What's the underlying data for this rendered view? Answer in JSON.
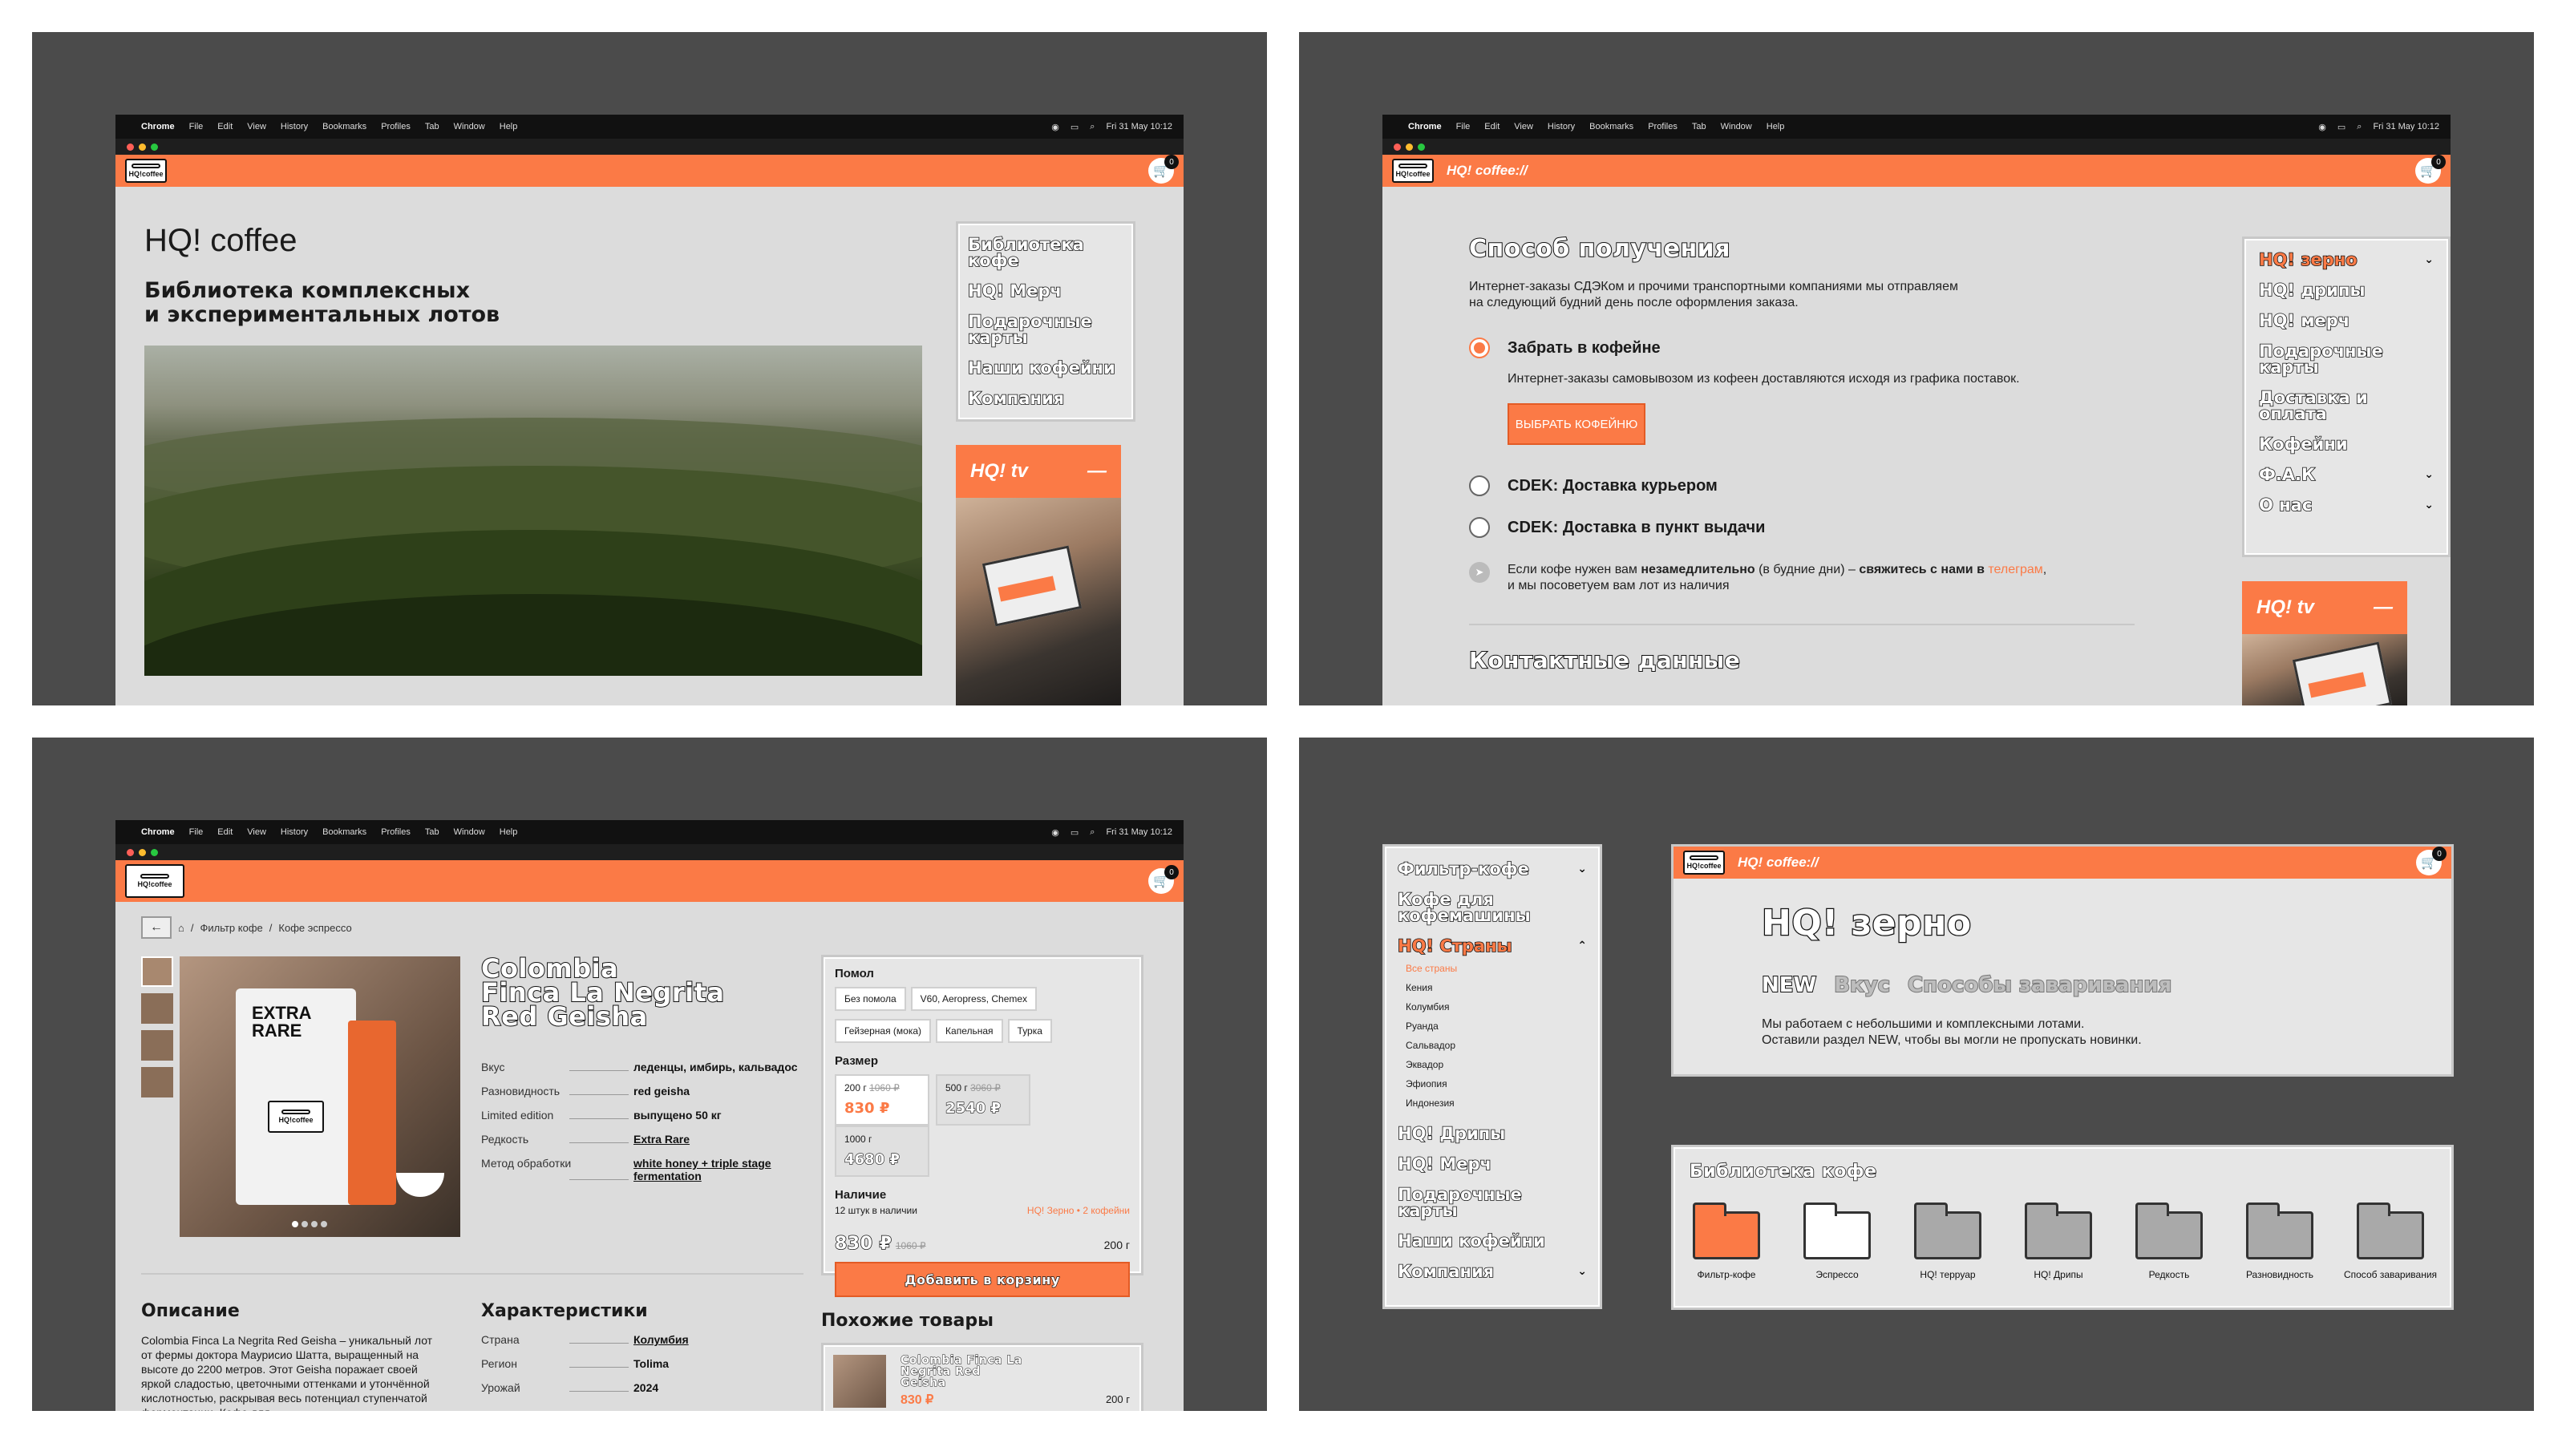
{
  "menubar": {
    "app": "Chrome",
    "items": [
      "File",
      "Edit",
      "View",
      "History",
      "Bookmarks",
      "Profiles",
      "Tab",
      "Window",
      "Help"
    ],
    "clock": "Fri 31 May 10:12"
  },
  "common": {
    "logo_text": "HQ!coffee",
    "brand": "HQ! coffee://",
    "cart_count": "0",
    "tv_label": "HQ! tv",
    "tv_toggle": "—",
    "accent": "#fb7a46"
  },
  "q1": {
    "title": "HQ! coffee",
    "subtitle_line1": "Библиотека комплексных",
    "subtitle_line2": "и экспериментальных лотов",
    "nav": [
      "Библиотека кофе",
      "HQ! Мерч",
      "Подарочные карты",
      "Наши кофейни",
      "Компания"
    ]
  },
  "q2": {
    "heading": "Способ получения",
    "intro_line1": "Интернет-заказы СДЭКом и прочими транспортными компаниями мы отправляем",
    "intro_line2": "на следующий будний день после оформления заказа.",
    "opt1_label": "Забрать в кофейне",
    "opt1_note": "Интернет-заказы самовывозом из кофеен доставляются исходя из графика поставок.",
    "opt1_button": "ВЫБРАТЬ КОФЕЙНЮ",
    "opt2_label": "CDEK: Доставка курьером",
    "opt3_label": "CDEK: Доставка в пункт выдачи",
    "tg_pre": "Если кофе нужен вам ",
    "tg_bold1": "незамедлительно",
    "tg_mid": " (в будние дни) – ",
    "tg_bold2": "свяжитесь с нами в",
    "tg_link": "телеграм",
    "tg_line2": "и мы посоветуем вам лот из наличия",
    "contacts": "Контактные данные",
    "nav": [
      {
        "label": "HQ! зерно",
        "chev": "⌄"
      },
      {
        "label": "HQ! дрипы",
        "chev": ""
      },
      {
        "label": "HQ! мерч",
        "chev": ""
      },
      {
        "label": "Подарочные карты",
        "chev": ""
      },
      {
        "label": "Доставка и оплата",
        "chev": ""
      },
      {
        "label": "Кофейни",
        "chev": ""
      },
      {
        "label": "Ф.А.К",
        "chev": "⌄"
      },
      {
        "label": "О нас",
        "chev": "⌄"
      }
    ]
  },
  "q3": {
    "breadcrumb_1": "Фильтр кофе",
    "breadcrumb_2": "Кофе эспрессо",
    "product_line1": "Colombia",
    "product_line2": "Finca La Negrita",
    "product_line3": "Red Geisha",
    "pack_text": "EXTRA RARE",
    "specs": [
      {
        "k": "Вкус",
        "v": "леденцы, имбирь, кальвадос"
      },
      {
        "k": "Разновидность",
        "v": "red geisha"
      },
      {
        "k": "Limited edition",
        "v": "выпущено 50 кг"
      },
      {
        "k": "Редкость",
        "v": "Extra Rare"
      },
      {
        "k": "Метод обработки",
        "v": "white honey + triple stage fermentation"
      }
    ],
    "grind_title": "Помол",
    "grind": [
      "Без помола",
      "V60, Aeropress, Chemex",
      "Гейзерная (мока)",
      "Капельная",
      "Турка"
    ],
    "size_title": "Размер",
    "sizes": [
      {
        "w": "200 г",
        "old": "1060 ₽",
        "price": "830 ₽"
      },
      {
        "w": "500 г",
        "old": "3060 ₽",
        "price": "2540 ₽"
      },
      {
        "w": "1000 г",
        "old": "",
        "price": "4680 ₽"
      }
    ],
    "stock_title": "Наличие",
    "stock_note": "12 штук в наличии",
    "stock_link": "HQ! Зерно • 2 кофейни",
    "total_price": "830 ₽",
    "total_old": "1060 ₽",
    "total_weight": "200 г",
    "add_button": "Добавить в корзину",
    "desc_title": "Описание",
    "desc_text": "Colombia Finca La Negrita Red Geisha – уникальный лот от фермы доктора Маурисио Шатта, выращенный на высоте до 2200 метров. Этот Geisha поражает своей яркой сладостью, цветочными оттенками и утончённой кислотностью, раскрывая весь потенциал ступенчатой ферментации. Кофе для",
    "char_title": "Характеристики",
    "chars": [
      {
        "k": "Страна",
        "v": "Колумбия"
      },
      {
        "k": "Регион",
        "v": "Tolima"
      },
      {
        "k": "Урожай",
        "v": "2024"
      }
    ],
    "similar_title": "Похожие товары",
    "similar_name": "Colombia Finca La Negrita Red Geisha",
    "similar_price": "830 ₽",
    "similar_weight": "200 г"
  },
  "q4": {
    "sidebar": [
      {
        "label": "Фильтр-кофе",
        "chev": "⌄",
        "active": false
      },
      {
        "label": "Кофе для кофемашины",
        "chev": "",
        "active": false
      },
      {
        "label": "HQ! Страны",
        "chev": "⌃",
        "active": true
      }
    ],
    "countries": [
      "Все страны",
      "Кения",
      "Колумбия",
      "Руанда",
      "Сальвадор",
      "Эквадор",
      "Эфиопия",
      "Индонезия"
    ],
    "sidebar_rest": [
      {
        "label": "HQ! Дрипы",
        "chev": ""
      },
      {
        "label": "HQ! Мерч",
        "chev": ""
      },
      {
        "label": "Подарочные карты",
        "chev": ""
      },
      {
        "label": "Наши кофейни",
        "chev": ""
      },
      {
        "label": "Компания",
        "chev": "⌄"
      }
    ],
    "heading": "HQ! зерно",
    "tabs": [
      "NEW",
      "Вкус",
      "Способы заваривания"
    ],
    "intro_line1": "Мы работаем с небольшими и комплексными лотами.",
    "intro_line2": "Оставили раздел NEW, чтобы вы могли не пропускать новинки.",
    "library_title": "Библиотека кофе",
    "folders": [
      "Фильтр-кофе",
      "Эспрессо",
      "HQ! терруар",
      "HQ! Дрипы",
      "Редкость",
      "Разновидность",
      "Способ заваривания"
    ]
  }
}
